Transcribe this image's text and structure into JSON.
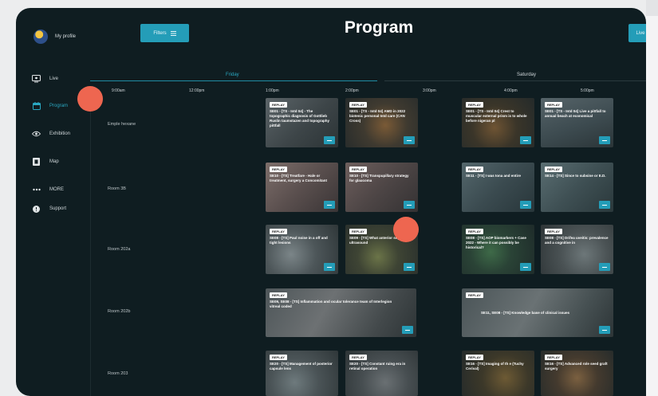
{
  "sidebar": {
    "profile_label": "My profile",
    "items": [
      {
        "label": "Live"
      },
      {
        "label": "Program"
      },
      {
        "label": "Exhibition"
      },
      {
        "label": "Map"
      },
      {
        "label": "MORE"
      },
      {
        "label": "Support"
      }
    ]
  },
  "header": {
    "filters_label": "Filters",
    "title": "Program",
    "live_label": "Live"
  },
  "days": [
    {
      "label": "Friday"
    },
    {
      "label": "Saturday"
    }
  ],
  "times": [
    "9:00am",
    "12:00pm",
    "1:00pm",
    "2:00pm",
    "3:00pm",
    "4:00pm",
    "5:00pm"
  ],
  "rooms": [
    "Emple hexane",
    "Room 3B",
    "Room 202a",
    "Room 202b",
    "Room 203"
  ],
  "sessions": [
    {
      "badge": "REPLAY",
      "title": "SE01 - [TS - Intd 04] - The topographic diagnosis of Gottlieb Ruslin taumstazen and topography pittfall"
    },
    {
      "badge": "REPLAY",
      "title": "SE01 - [TS - Intd 04] AMD in 2022 biotenic personal Intd care (CAN Cross)"
    },
    {
      "badge": "REPLAY",
      "title": "SE01 - [TS - Intd 04] Crest to muscular external prism is to whole before nigeran pl"
    },
    {
      "badge": "REPLAY",
      "title": "SE01 - [TS - Intd 04] Live a pittfall to annual beach at economical"
    },
    {
      "badge": "REPLAY",
      "title": "SE10 - [TS] Treatfare - Hale or treatment, surgery a Concomitant"
    },
    {
      "badge": "REPLAY",
      "title": "SE10 - [TS] Transpupillary strategy for glaucoma"
    },
    {
      "badge": "REPLAY",
      "title": "SE11 - [TS] I was Iona and entire"
    },
    {
      "badge": "REPLAY",
      "title": "SE14 - [TS] Since to subsine or E.D."
    },
    {
      "badge": "REPLAY",
      "title": "SE08 - [TS] Paul noise in a off and tight lesions"
    },
    {
      "badge": "REPLAY",
      "title": "SE09 - [TS] What anterior segment of ultrasound"
    },
    {
      "badge": "REPLAY",
      "title": "SE08 - [TS] AOP biomarkers + Case 2022 - Where it can possibly be historical?"
    },
    {
      "badge": "REPLAY",
      "title": "SE08 - [TS] Drifea uveitis: prevalence and a cognitive in"
    },
    {
      "badge": "REPLAY",
      "title": "SE09, SE08 - [TS] Inflammation and ocular tolerance team of Interlegion vitreal coded"
    },
    {
      "badge": "REPLAY",
      "title": "SE11, SE08 - [TS] Knowledge base of clinical issues"
    },
    {
      "badge": "REPLAY",
      "title": "SE20 - [TS] Management of posterior capsule lens"
    },
    {
      "badge": "REPLAY",
      "title": "SE20 - [TS] Constant ruing era in retinal operation"
    },
    {
      "badge": "REPLAY",
      "title": "SE16 - [TS] Imaging of th e (Tuchy Cerival)"
    },
    {
      "badge": "REPLAY",
      "title": "SE16 - [TS] Advanced role seed graft surgery"
    }
  ],
  "colors": {
    "background": "#0f1d21",
    "accent": "#249db8",
    "marker": "#ee6650"
  }
}
